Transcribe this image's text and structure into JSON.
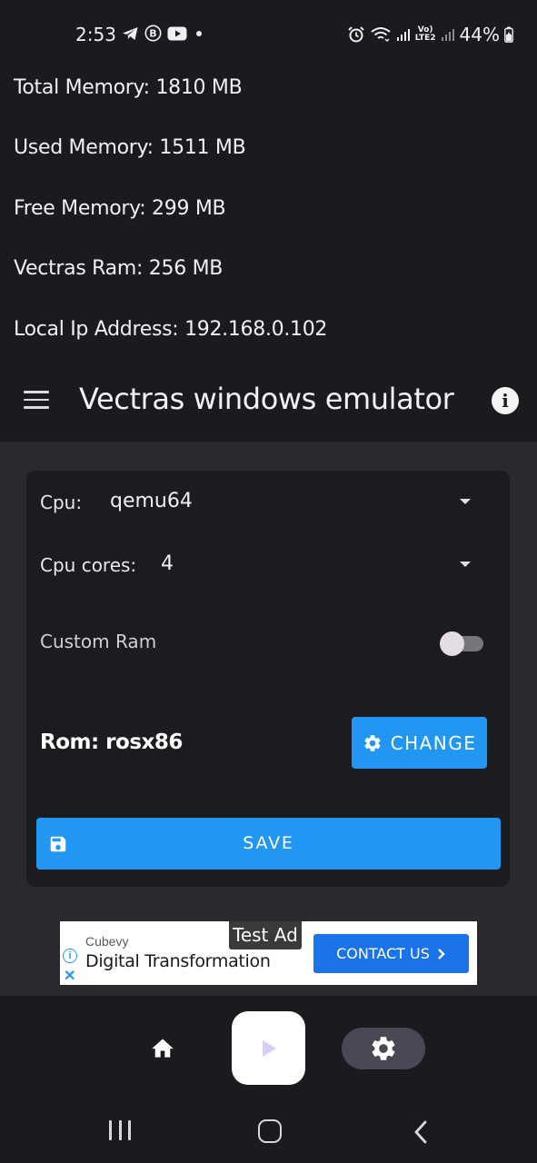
{
  "status_bar": {
    "time": "2:53",
    "left_icons": [
      "telegram-icon",
      "b-icon",
      "youtube-icon",
      "dot-icon"
    ],
    "right_icons": [
      "alarm-icon",
      "wifi-icon",
      "signal-icon",
      "volte-icon",
      "signal-icon-2",
      "battery-icon"
    ],
    "volte_label_top": "Vo)",
    "volte_label_bottom": "LTE2",
    "battery": "44%"
  },
  "info": {
    "total_memory": "Total Memory: 1810 MB",
    "used_memory": "Used Memory: 1511 MB",
    "free_memory": "Free Memory: 299 MB",
    "vectras_ram": "Vectras Ram: 256 MB",
    "local_ip": "Local Ip Address: 192.168.0.102"
  },
  "appbar": {
    "title": "Vectras windows emulator",
    "info_glyph": "i"
  },
  "settings": {
    "cpu_label": "Cpu:",
    "cpu_value": "qemu64",
    "cores_label": "Cpu cores:",
    "cores_value": "4",
    "custom_ram_label": "Custom Ram",
    "custom_ram_enabled": false,
    "rom_label": "Rom: rosx86",
    "change_label": "CHANGE",
    "save_label": "SAVE"
  },
  "ad": {
    "tag": "Test Ad",
    "brand": "Cubevy",
    "title": "Digital Transformation",
    "cta": "CONTACT US",
    "info_glyph": "i",
    "close_glyph": "✕"
  },
  "bottom_nav": {
    "items": [
      "home-icon",
      "play-icon",
      "settings-icon"
    ],
    "active": "settings-icon"
  },
  "colors": {
    "background": "#1b1b1f",
    "content_bg": "#2a2a2e",
    "card_bg": "#1c1c20",
    "accent": "#2196f3",
    "ad_cta": "#1a73e8"
  }
}
